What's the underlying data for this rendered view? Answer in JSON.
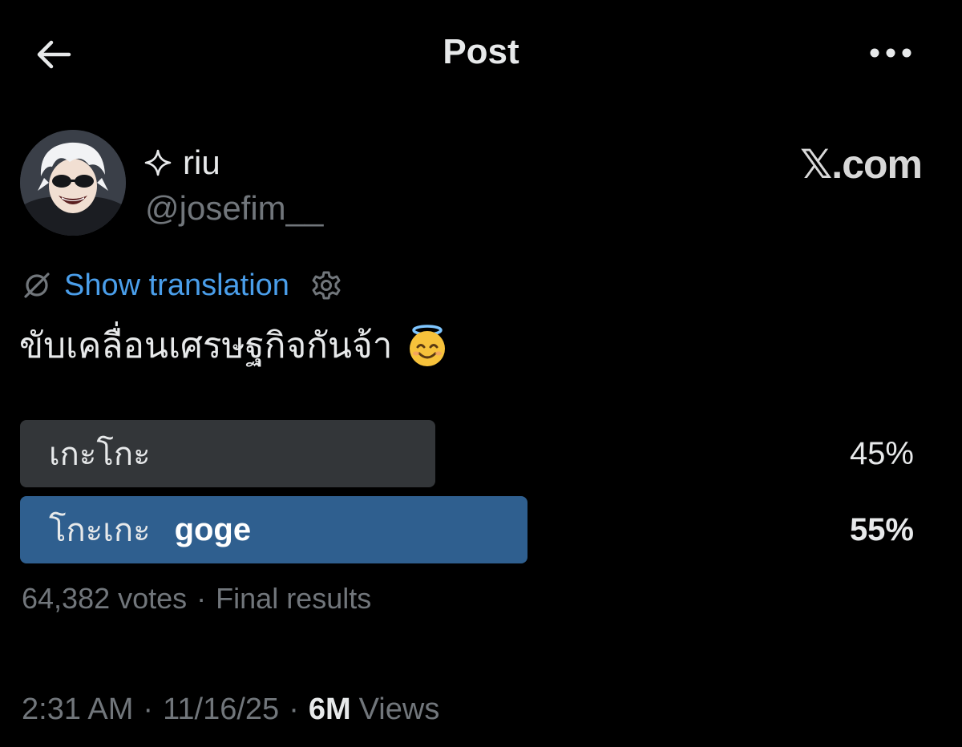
{
  "header": {
    "title": "Post"
  },
  "author": {
    "display_name": "riu",
    "name_prefix_icon": "sparkle-icon",
    "handle": "@josefim__",
    "avatar": "avatar-icon"
  },
  "brand": {
    "logo_letter": "𝕏",
    "domain": ".com"
  },
  "translation": {
    "label": "Show translation",
    "accent": "#4a9eea"
  },
  "post": {
    "text": "ขับเคลื่อนเศรษฐกิจกันจ้า",
    "emoji": "😇"
  },
  "poll": {
    "options": [
      {
        "label": "เกะโกะ",
        "extra": "",
        "percent": "45%",
        "share": 0.45,
        "bar_color": "#333639"
      },
      {
        "label": "โกะเกะ",
        "extra": "goge",
        "percent": "55%",
        "share": 0.55,
        "bar_color": "#2f5f8f"
      }
    ],
    "votes": "64,382 votes",
    "status": "Final results"
  },
  "meta": {
    "time": "2:31 AM",
    "date": "11/16/25",
    "views_count": "6M",
    "views_label": "Views"
  }
}
